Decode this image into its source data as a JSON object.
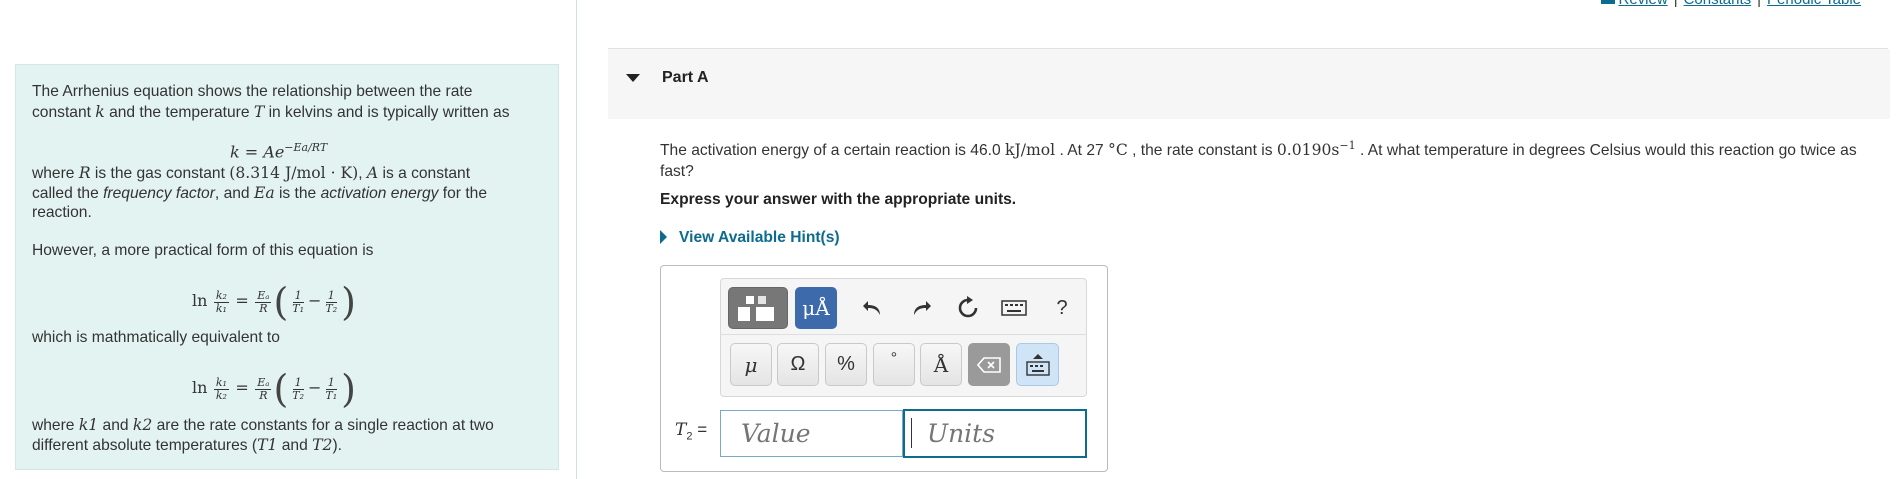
{
  "top_links": {
    "review": "Review",
    "constants": "Constants",
    "periodic_table": "Periodic Table",
    "separator": "|"
  },
  "intro": {
    "p1_a": "The Arrhenius equation shows the relationship between the rate",
    "p1_b1": "constant ",
    "p1_k": "k",
    "p1_b2": " and the temperature ",
    "p1_T": "T",
    "p1_b3": " in kelvins and is typically written as",
    "eq1": "k = Ae",
    "eq1_exp": "−Ea/RT",
    "p2_a1": "where ",
    "p2_R": "R",
    "p2_a2": " is the gas constant ",
    "p2_gas": "(8.314 J/mol · K)",
    "p2_a3": ", ",
    "p2_A": "A",
    "p2_a4": " is a constant",
    "p2_b1": "called the ",
    "p2_ff": "frequency factor",
    "p2_b2": ", and ",
    "p2_Ea": "Ea",
    "p2_b3": " is the ",
    "p2_ae": "activation energy",
    "p2_b4": " for the",
    "p2_c": "reaction.",
    "p3": "However, a more practical form of this equation is",
    "p4": "which is mathmatically equivalent to",
    "p5_a1": "where ",
    "p5_k1": "k1",
    "p5_a2": " and ",
    "p5_k2": "k2",
    "p5_a3": " are the rate constants for a single reaction at two",
    "p5_b1": "different absolute temperatures (",
    "p5_T1": "T1",
    "p5_b2": " and ",
    "p5_T2": "T2",
    "p5_b3": ")."
  },
  "part": {
    "title": "Part A"
  },
  "question": {
    "t1": "The activation energy of a certain reaction is 46.0 ",
    "u1": "kJ/mol",
    "t2": " . At 27 ",
    "u2": "°C",
    "t3": " , the rate constant is ",
    "u3": "0.0190s",
    "u3_exp": "−1",
    "t4": " . At what temperature in degrees Celsius would this reaction go twice as fast?",
    "instruction": "Express your answer with the appropriate units.",
    "hint": "View Available Hint(s)"
  },
  "toolbar": {
    "units_label": "μÅ",
    "help": "?",
    "mu": "μ",
    "omega": "Ω",
    "percent": "%",
    "degree": "°",
    "angstrom": "Å"
  },
  "answer": {
    "label": "T2 =",
    "value_placeholder": "Value",
    "units_placeholder": "Units"
  }
}
